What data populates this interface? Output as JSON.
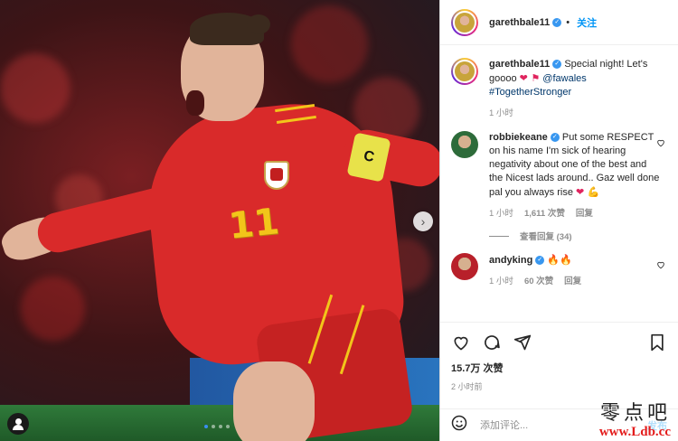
{
  "post": {
    "media": {
      "jersey_number": "11",
      "armband_letter": "C",
      "carousel_dots": 4,
      "active_dot": 0
    },
    "header": {
      "username": "garethbale11",
      "separator": "•",
      "follow_label": "关注"
    },
    "caption": {
      "username": "garethbale11",
      "text": "Special night! Let's goooo",
      "emojis": "❤ ⚑",
      "mention": "@fawales",
      "hashtag": "#TogetherStronger",
      "time": "1 小时"
    },
    "comments": [
      {
        "username": "robbiekeane",
        "text": "Put some RESPECT on his name I'm sick of hearing negativity about one of the best and the Nicest lads around.. Gaz well done pal you always rise",
        "emojis": "❤ 💪",
        "time": "1 小时",
        "likes": "1,611 次赞",
        "reply_label": "回复",
        "view_replies": "查看回复 (34)"
      },
      {
        "username": "andyking",
        "text": "",
        "emojis": "🔥🔥",
        "time": "1 小时",
        "likes": "60 次赞",
        "reply_label": "回复"
      }
    ],
    "actions": {
      "icons": [
        "heart-icon",
        "comment-icon",
        "share-icon",
        "bookmark-icon"
      ],
      "likes_count": "15.7万 次赞",
      "time_ago": "2 小时前"
    },
    "add_comment": {
      "placeholder": "添加评论...",
      "post_label": "发布"
    }
  },
  "watermark": {
    "chinese": "零点吧",
    "url": "www.Ldb.cc"
  },
  "colors": {
    "accent": "#0095f6",
    "verified": "#3897f0",
    "muted": "#8e8e8e",
    "jersey": "#d92a2a",
    "number": "#f2c51a"
  }
}
